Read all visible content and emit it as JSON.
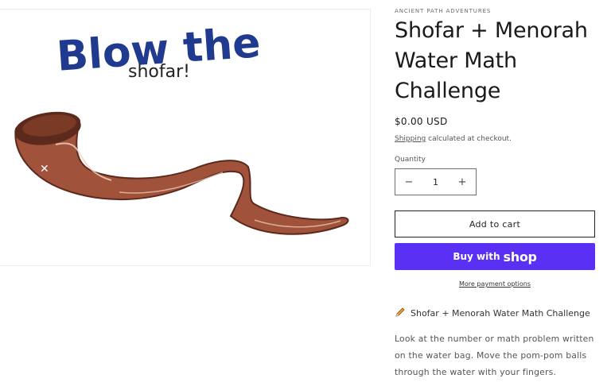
{
  "product": {
    "image_text_line1": "Blow the",
    "image_text_line2": "shofar!",
    "vendor": "ANCIENT PATH ADVENTURES",
    "title": "Shofar + Menorah Water Math Challenge",
    "price": "$0.00 USD",
    "shipping_link": "Shipping",
    "shipping_suffix": " calculated at checkout.",
    "quantity_label": "Quantity",
    "quantity_value": "1",
    "minus_symbol": "−",
    "plus_symbol": "+",
    "add_to_cart": "Add to cart",
    "buy_with": "Buy with",
    "buy_brand": "shop",
    "more_payment": "More payment options",
    "description_heading": "Shofar + Menorah Water Math Challenge",
    "description_icon": "pencil-icon",
    "description": "Look at the number or math problem written on the water bag. Move the pom-pom balls through the water with your fingers."
  },
  "colors": {
    "shop_pay": "#5a31f4",
    "headline_blue": "#1f3a8f",
    "horn_brown": "#a0523a",
    "horn_dark": "#5c2a1c"
  }
}
